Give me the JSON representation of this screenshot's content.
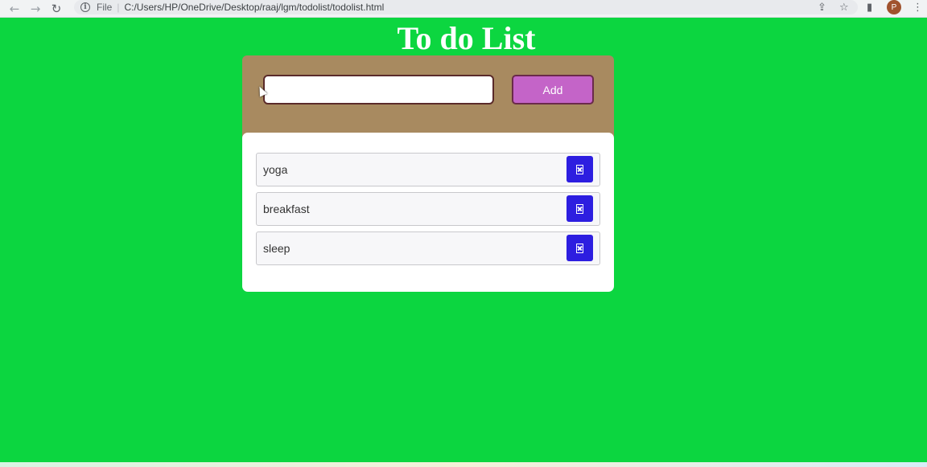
{
  "browser": {
    "scheme_label": "File",
    "url": "C:/Users/HP/OneDrive/Desktop/raaj/lgm/todolist/todolist.html",
    "avatar_letter": "P",
    "icons": [
      "back-arrow-icon",
      "forward-arrow-icon",
      "reload-icon",
      "info-icon",
      "share-icon",
      "star-icon",
      "side-panel-icon",
      "kebab-menu-icon"
    ]
  },
  "page": {
    "title": "To do List",
    "colors": {
      "background": "#0cd640",
      "input_panel": "#a88a60",
      "add_button": "#c464c8",
      "delete_button": "#2d1ee0"
    }
  },
  "input": {
    "value": "",
    "add_label": "Add"
  },
  "todos": [
    {
      "text": "yoga"
    },
    {
      "text": "breakfast"
    },
    {
      "text": "sleep"
    }
  ]
}
